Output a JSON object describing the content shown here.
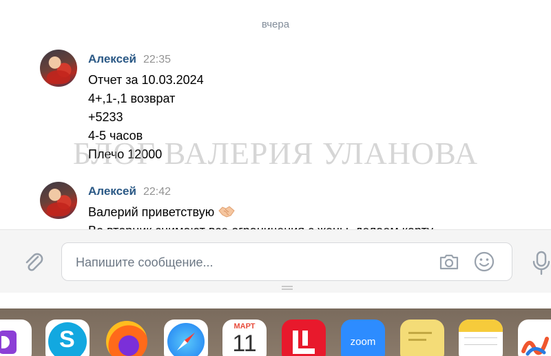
{
  "chat": {
    "date_separator": "вчера",
    "messages": [
      {
        "author": "Алексей",
        "time": "22:35",
        "lines": [
          "Отчет за 10.03.2024",
          "4+,1-,1 возврат",
          "+5233",
          "4-5 часов",
          "Плечо 12000"
        ]
      },
      {
        "author": "Алексей",
        "time": "22:42",
        "lines": [
          "Валерий приветствую",
          "Во вторник снимают все ограничения с жены, делаем карту"
        ],
        "emoji": "handshake-icon"
      }
    ],
    "watermark": "БЛОГ ВАЛЕРИЯ УЛАНОВА"
  },
  "composer": {
    "placeholder": "Напишите сообщение..."
  },
  "dock": {
    "calendar_month": "МАРТ",
    "calendar_day": "11",
    "zoom_label": "zoom",
    "skype_letter": "S",
    "apps": [
      "daily-app-icon",
      "skype-app-icon",
      "firefox-app-icon",
      "safari-app-icon",
      "calendar-app-icon",
      "lingualeo-app-icon",
      "zoom-app-icon",
      "stickies-app-icon",
      "notes-app-icon",
      "freeform-app-icon"
    ]
  },
  "colors": {
    "author": "#2a5885",
    "time": "#939393",
    "date_separator": "#818c99",
    "composer_bg": "#f5f5f5"
  }
}
